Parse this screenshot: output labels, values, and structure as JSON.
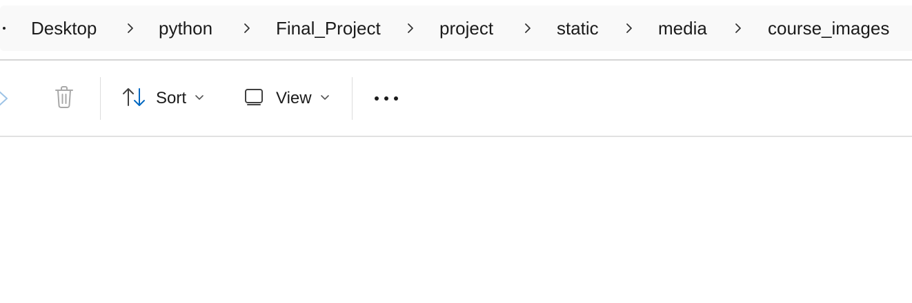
{
  "breadcrumb": {
    "items": [
      {
        "label": "Desktop"
      },
      {
        "label": "python"
      },
      {
        "label": "Final_Project"
      },
      {
        "label": "project"
      },
      {
        "label": "static"
      },
      {
        "label": "media"
      },
      {
        "label": "course_images"
      }
    ]
  },
  "toolbar": {
    "share_icon": "share-icon",
    "delete_icon": "delete-icon",
    "sort_label": "Sort",
    "view_label": "View",
    "more_icon": "more-options-icon"
  },
  "colors": {
    "address_bar_bg": "#f9f9f9",
    "sort_icon_accent": "#0067c0",
    "disabled_icon": "#a8a8a8"
  }
}
